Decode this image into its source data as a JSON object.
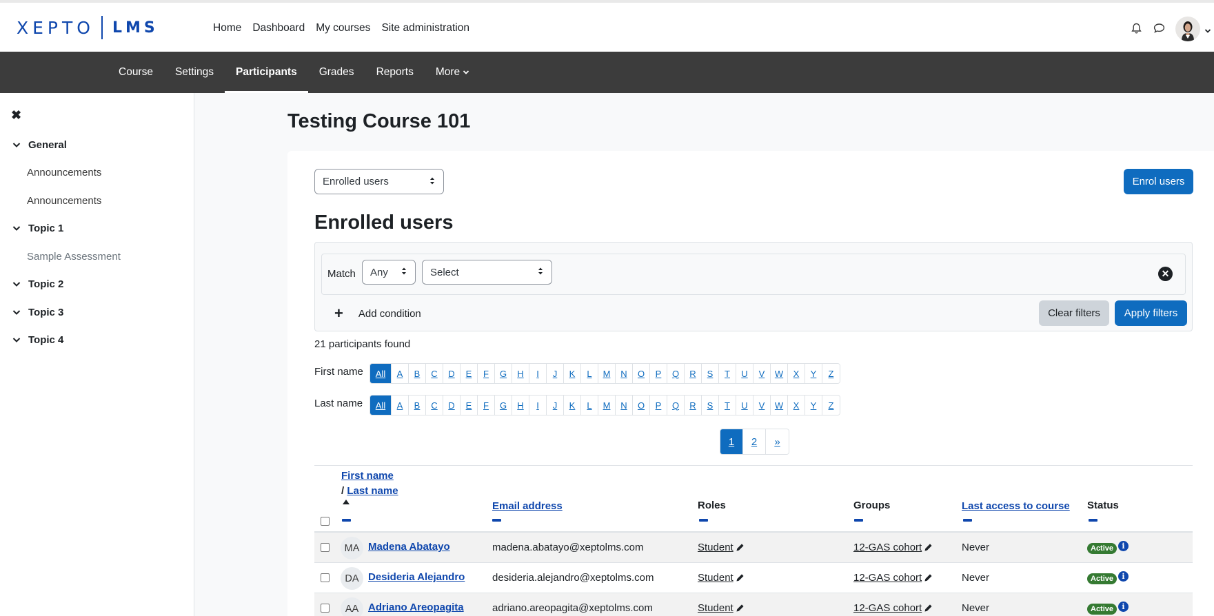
{
  "brand": {
    "logo_text": "XEPTO",
    "logo_suffix": "LMS"
  },
  "primary_nav": [
    "Home",
    "Dashboard",
    "My courses",
    "Site administration"
  ],
  "secondary_nav": {
    "items": [
      "Course",
      "Settings",
      "Participants",
      "Grades",
      "Reports",
      "More"
    ],
    "active": "Participants"
  },
  "drawer": {
    "close": "✖",
    "items": [
      {
        "type": "section",
        "label": "General"
      },
      {
        "type": "activity",
        "label": "Announcements"
      },
      {
        "type": "activity",
        "label": "Announcements"
      },
      {
        "type": "section",
        "label": "Topic 1"
      },
      {
        "type": "activity",
        "label": "Sample Assessment"
      },
      {
        "type": "section",
        "label": "Topic 2"
      },
      {
        "type": "section",
        "label": "Topic 3"
      },
      {
        "type": "section",
        "label": "Topic 4"
      }
    ]
  },
  "page": {
    "title": "Testing Course 101",
    "view_select": "Enrolled users",
    "enrol_button": "Enrol users",
    "heading": "Enrolled users"
  },
  "filters": {
    "match_label": "Match",
    "match_value": "Any",
    "condition_placeholder": "Select",
    "add_condition": "Add condition",
    "clear": "Clear filters",
    "apply": "Apply filters"
  },
  "results": {
    "found_text": "21 participants found"
  },
  "initials": {
    "first_label": "First name",
    "last_label": "Last name",
    "all": "All",
    "letters": [
      "A",
      "B",
      "C",
      "D",
      "E",
      "F",
      "G",
      "H",
      "I",
      "J",
      "K",
      "L",
      "M",
      "N",
      "O",
      "P",
      "Q",
      "R",
      "S",
      "T",
      "U",
      "V",
      "W",
      "X",
      "Y",
      "Z"
    ]
  },
  "pagination": {
    "pages": [
      "1",
      "2"
    ],
    "next": "»",
    "current": "1"
  },
  "table": {
    "headers": {
      "first_name": "First name",
      "last_name": "Last name",
      "email": "Email address",
      "roles": "Roles",
      "groups": "Groups",
      "last_access": "Last access to course",
      "status": "Status"
    },
    "rows": [
      {
        "initials": "MA",
        "name": "Madena Abatayo",
        "email": "madena.abatayo@xeptolms.com",
        "role": "Student",
        "group": "12-GAS cohort",
        "last_access": "Never",
        "status": "Active"
      },
      {
        "initials": "DA",
        "name": "Desideria Alejandro",
        "email": "desideria.alejandro@xeptolms.com",
        "role": "Student",
        "group": "12-GAS cohort",
        "last_access": "Never",
        "status": "Active"
      },
      {
        "initials": "AA",
        "name": "Adriano Areopagita",
        "email": "adriano.areopagita@xeptolms.com",
        "role": "Student",
        "group": "12-GAS cohort",
        "last_access": "Never",
        "status": "Active"
      }
    ]
  },
  "colors": {
    "primary": "#0f6cbf",
    "link": "#0f47ad",
    "secondary_nav_bg": "#3c3c3c",
    "active_badge": "#357a32"
  },
  "icons": [
    "bell-icon",
    "chat-icon",
    "chevron-down-icon",
    "close-icon",
    "plus-icon",
    "pencil-icon",
    "info-icon",
    "sort-up-icon"
  ]
}
